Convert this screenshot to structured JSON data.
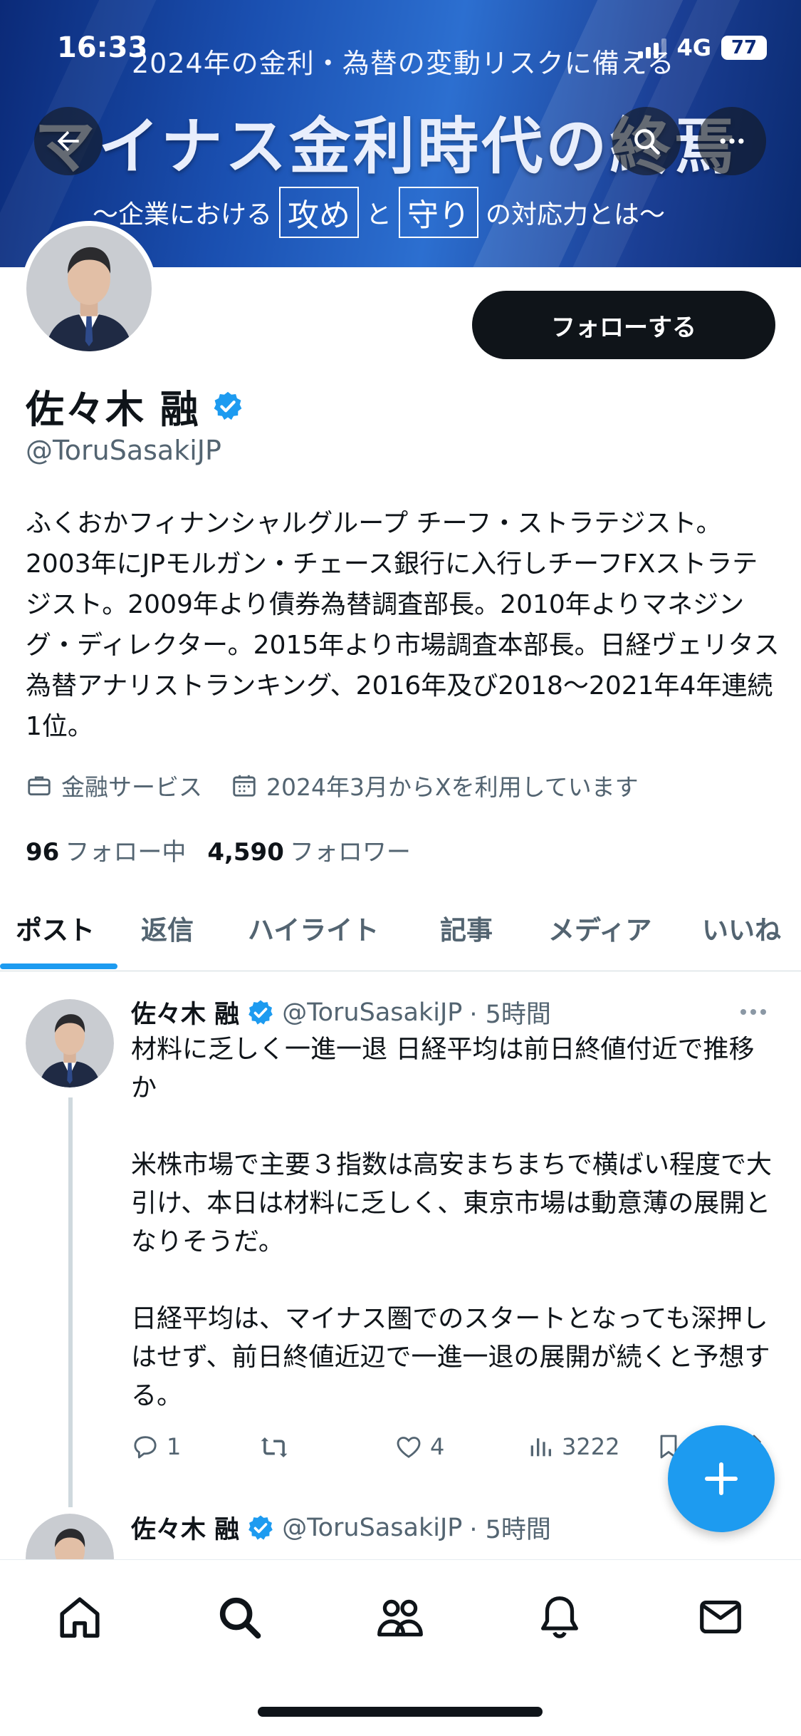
{
  "status_bar": {
    "time": "16:33",
    "network": "4G",
    "battery": "77"
  },
  "banner": {
    "top_line": "2024年の金利・為替の変動リスクに備える",
    "main_title": "マイナス金利時代の終焉",
    "subtitle_pre": "〜企業における",
    "subtitle_box1": "攻め",
    "subtitle_mid": "と",
    "subtitle_box2": "守り",
    "subtitle_post": "の対応力とは〜"
  },
  "profile": {
    "name": "佐々木 融",
    "handle": "@ToruSasakiJP",
    "follow_label": "フォローする",
    "bio": "ふくおかフィナンシャルグループ チーフ・ストラテジスト。2003年にJPモルガン・チェース銀行に入行しチーフFXストラテジスト。2009年より債券為替調査部長。2010年よりマネジング・ディレクター。2015年より市場調査本部長。日経ヴェリタス為替アナリストランキング、2016年及び2018〜2021年4年連続1位。",
    "category": "金融サービス",
    "joined": "2024年3月からXを利用しています",
    "following_count": "96",
    "following_label": "フォロー中",
    "followers_count": "4,590",
    "followers_label": "フォロワー"
  },
  "tabs": [
    {
      "label": "ポスト"
    },
    {
      "label": "返信"
    },
    {
      "label": "ハイライト"
    },
    {
      "label": "記事"
    },
    {
      "label": "メディア"
    },
    {
      "label": "いいね"
    }
  ],
  "posts": [
    {
      "name": "佐々木 融",
      "handle": "@ToruSasakiJP",
      "time": "· 5時間",
      "paragraphs": [
        "材料に乏しく一進一退 日経平均は前日終値付近で推移か",
        "米株市場で主要３指数は高安まちまちで横ばい程度で大引け、本日は材料に乏しく、東京市場は動意薄の展開となりそうだ。",
        "日経平均は、マイナス圏でのスタートとなっても深押しはせず、前日終値近辺で一進一退の展開が続くと予想する。"
      ],
      "replies": "1",
      "reposts": "",
      "likes": "4",
      "views": "3222"
    },
    {
      "name": "佐々木 融",
      "handle": "@ToruSasakiJP",
      "time": "· 5時間"
    }
  ],
  "colors": {
    "accent": "#1d9bf0",
    "text": "#0f1419",
    "secondary": "#536471"
  },
  "icons": [
    "back-arrow-icon",
    "search-icon",
    "more-icon",
    "verified-badge-icon",
    "briefcase-icon",
    "calendar-icon",
    "reply-icon",
    "repost-icon",
    "like-icon",
    "views-icon",
    "bookmark-icon",
    "share-icon",
    "plus-icon",
    "home-icon",
    "explore-icon",
    "communities-icon",
    "notifications-icon",
    "messages-icon"
  ]
}
